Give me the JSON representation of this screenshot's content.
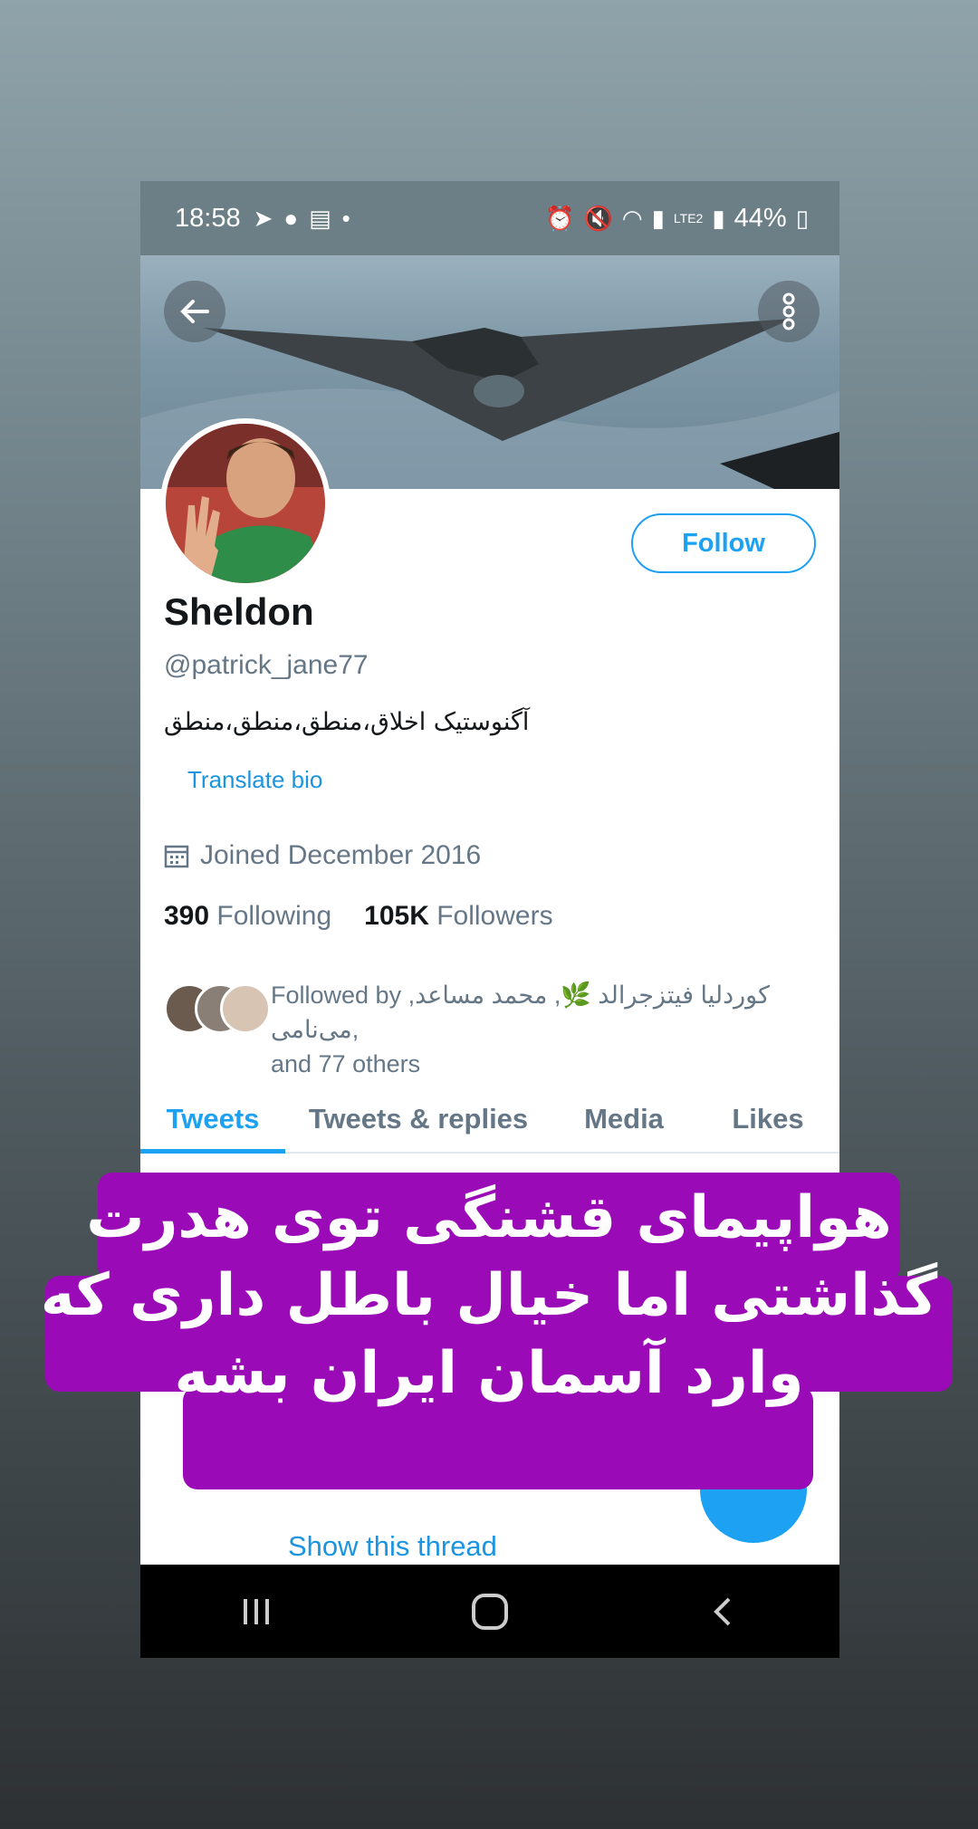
{
  "status_bar": {
    "time": "18:58",
    "battery": "44%",
    "network": "LTE2"
  },
  "header": {
    "back_icon": "arrow-left-icon",
    "more_icon": "more-vertical-icon"
  },
  "profile": {
    "follow_label": "Follow",
    "name": "Sheldon",
    "handle": "@patrick_jane77",
    "bio": "آگنوستیک    اخلاق،منطق،منطق،منطق",
    "translate_label": "Translate bio",
    "joined": "Joined December 2016",
    "following_count": "390",
    "following_label": "Following",
    "followers_count": "105K",
    "followers_label": "Followers",
    "followed_by": "Followed by کوردلیا فیتزجرالد 🌿, محمد مساعد, می‌نامی,",
    "followed_by_rest": "and 77 others"
  },
  "tabs": [
    {
      "label": "Tweets",
      "active": true
    },
    {
      "label": "Tweets & replies",
      "active": false
    },
    {
      "label": "Media",
      "active": false
    },
    {
      "label": "Likes",
      "active": false
    }
  ],
  "show_thread_label": "Show this thread",
  "caption": {
    "line1": "هواپیمای قشنگی توی هدرت",
    "line2": "گذاشتی اما خیال باطل داری که",
    "line3": "وارد آسمان ایران بشه"
  },
  "colors": {
    "accent": "#1da1f2",
    "caption_bg": "#9b0ab7",
    "status_bar": "#6c7f87"
  }
}
